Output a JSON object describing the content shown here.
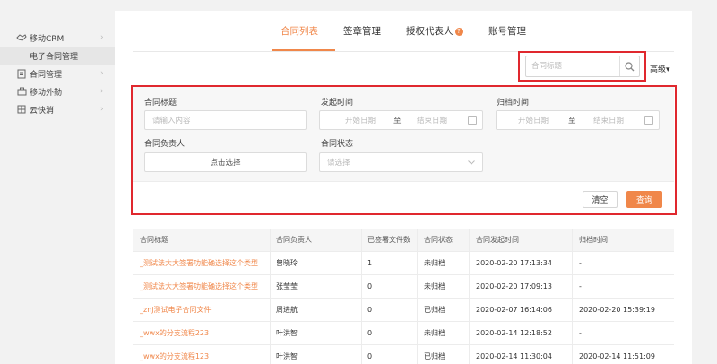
{
  "sidebar": {
    "items": [
      {
        "label": "移动CRM",
        "icon": "handshake-icon",
        "chevron": "›"
      },
      {
        "label": "电子合同管理"
      },
      {
        "label": "合同管理",
        "icon": "document-icon",
        "chevron": "›"
      },
      {
        "label": "移动外勤",
        "icon": "briefcase-icon",
        "chevron": "›"
      },
      {
        "label": "云快消",
        "icon": "grid-icon",
        "chevron": "›"
      }
    ]
  },
  "tabs": [
    {
      "label": "合同列表",
      "active": true
    },
    {
      "label": "签章管理"
    },
    {
      "label": "授权代表人",
      "badge": "?"
    },
    {
      "label": "账号管理"
    }
  ],
  "search": {
    "placeholder": "合同标题",
    "advanced_label": "高级▾"
  },
  "filters": {
    "title_label": "合同标题",
    "title_placeholder": "请输入内容",
    "start_time_label": "发起时间",
    "archive_time_label": "归档时间",
    "start_date_placeholder": "开始日期",
    "end_date_placeholder": "结束日期",
    "range_separator": "至",
    "owner_label": "合同负责人",
    "owner_button": "点击选择",
    "status_label": "合同状态",
    "status_placeholder": "请选择",
    "clear_label": "清空",
    "query_label": "查询"
  },
  "table": {
    "headers": [
      "合同标题",
      "合同负责人",
      "已签署文件数",
      "合同状态",
      "合同发起时间",
      "归档时间"
    ],
    "rows": [
      [
        "_测试法大大签署功能确选择这个类型",
        "曾晓玲",
        "1",
        "未归档",
        "2020-02-20 17:13:34",
        "-"
      ],
      [
        "_测试法大大签署功能确选择这个类型",
        "张莹莹",
        "0",
        "未归档",
        "2020-02-20 17:09:13",
        "-"
      ],
      [
        "_znj测试电子合同文件",
        "周进航",
        "0",
        "已归档",
        "2020-02-07 16:14:06",
        "2020-02-20 15:39:19"
      ],
      [
        "_wwx的分支流程223",
        "叶洪智",
        "0",
        "未归档",
        "2020-02-14 12:18:52",
        "-"
      ],
      [
        "_wwx的分支流程123",
        "叶洪智",
        "0",
        "已归档",
        "2020-02-14 11:30:04",
        "2020-02-14 11:51:09"
      ]
    ]
  },
  "colors": {
    "accent": "#f0874a",
    "highlight": "#e0282e"
  }
}
